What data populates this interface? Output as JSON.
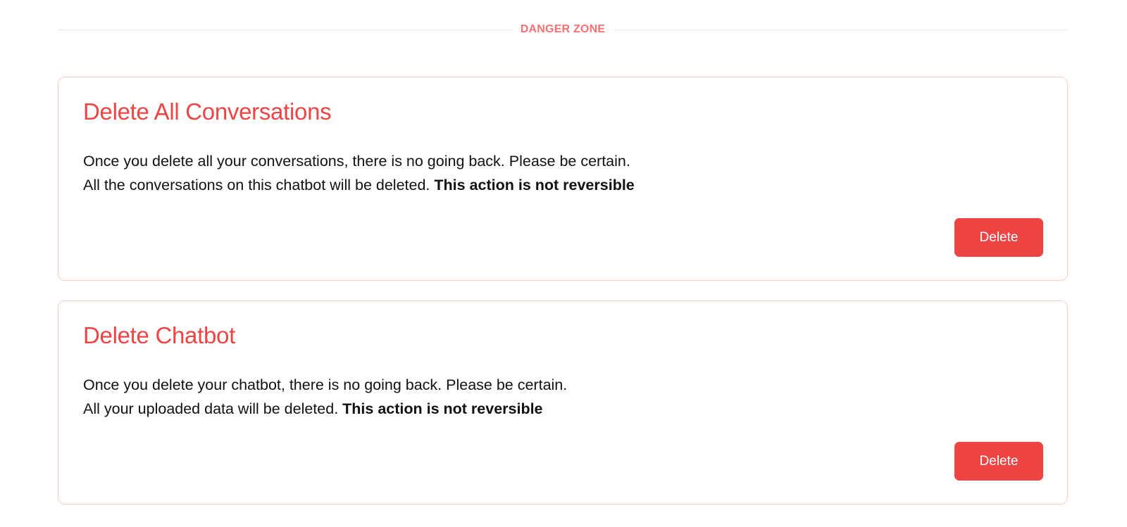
{
  "section": {
    "label": "DANGER ZONE"
  },
  "cards": [
    {
      "title": "Delete All Conversations",
      "line1": "Once you delete all your conversations, there is no going back. Please be certain.",
      "line2": "All the conversations on this chatbot will be deleted.",
      "warning": "This action is not reversible",
      "button_label": "Delete"
    },
    {
      "title": "Delete Chatbot",
      "line1": "Once you delete your chatbot, there is no going back. Please be certain.",
      "line2": "All your uploaded data will be deleted.",
      "warning": "This action is not reversible",
      "button_label": "Delete"
    }
  ],
  "colors": {
    "danger": "#ef4444",
    "danger_light": "#f87171",
    "card_border": "#fecaca",
    "divider": "#e5e7eb"
  }
}
